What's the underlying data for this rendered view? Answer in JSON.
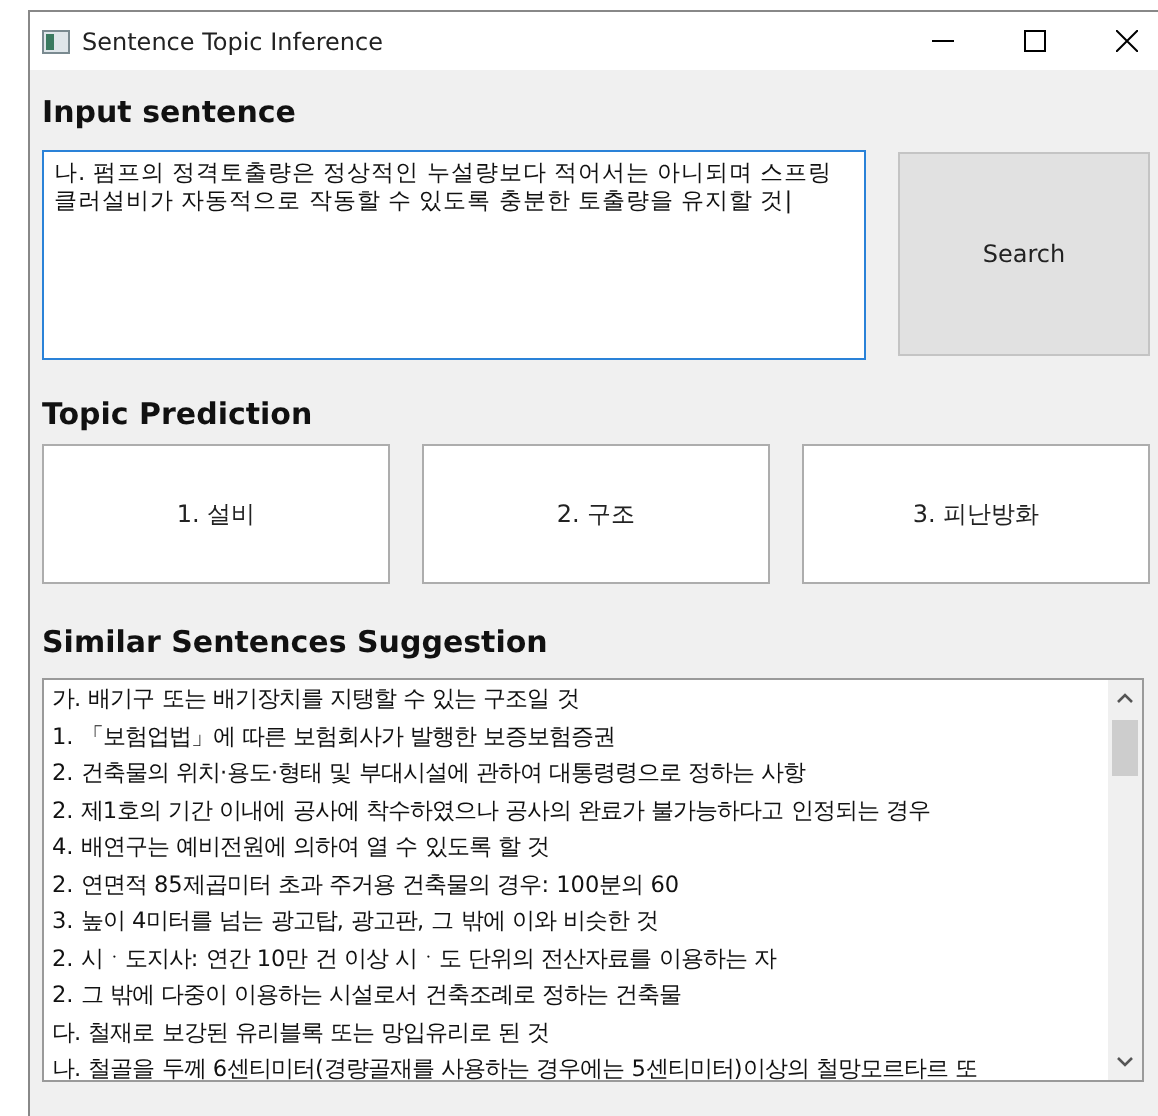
{
  "window": {
    "title": "Sentence Topic Inference"
  },
  "input": {
    "heading": "Input sentence",
    "value": "나. 펌프의 정격토출량은 정상적인 누설량보다 적어서는 아니되며 스프링클러설비가 자동적으로 작동할 수 있도록 충분한 토출량을 유지할 것|",
    "button": "Search"
  },
  "prediction": {
    "heading": "Topic Prediction",
    "topics": [
      "1. 설비",
      "2. 구조",
      "3. 피난방화"
    ]
  },
  "suggestions": {
    "heading": "Similar Sentences Suggestion",
    "items": [
      "가. 배기구 또는 배기장치를 지탱할 수 있는 구조일 것",
      "1. 「보험업법」에 따른 보험회사가 발행한 보증보험증권",
      "2. 건축물의 위치·용도·형태 및 부대시설에 관하여 대통령령으로 정하는 사항",
      "2. 제1호의 기간 이내에 공사에 착수하였으나 공사의 완료가 불가능하다고 인정되는 경우",
      "4. 배연구는 예비전원에 의하여 열 수 있도록 할 것",
      "2. 연면적 85제곱미터 초과 주거용 건축물의 경우: 100분의 60",
      "3. 높이 4미터를 넘는 광고탑, 광고판, 그 밖에 이와 비슷한 것",
      "2. 시ㆍ도지사: 연간 10만 건 이상 시ㆍ도 단위의 전산자료를 이용하는 자",
      "2. 그 밖에 다중이 이용하는 시설로서 건축조례로 정하는 건축물",
      "다. 철재로 보강된 유리블록 또는 망입유리로 된 것",
      "나. 철골을 두께 6센티미터(경량골재를 사용하는 경우에는 5센티미터)이상의 철망모르타르 또"
    ]
  }
}
